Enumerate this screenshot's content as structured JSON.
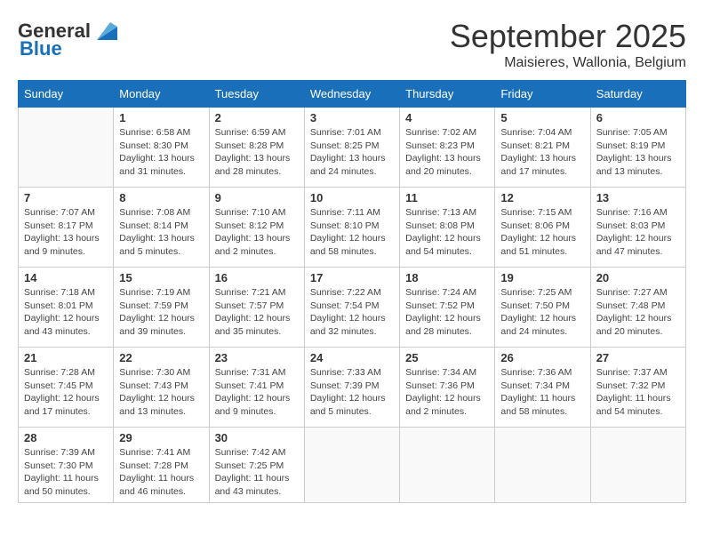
{
  "header": {
    "logo_general": "General",
    "logo_blue": "Blue",
    "month_title": "September 2025",
    "location": "Maisieres, Wallonia, Belgium"
  },
  "days_of_week": [
    "Sunday",
    "Monday",
    "Tuesday",
    "Wednesday",
    "Thursday",
    "Friday",
    "Saturday"
  ],
  "weeks": [
    [
      {
        "day": "",
        "info": ""
      },
      {
        "day": "1",
        "info": "Sunrise: 6:58 AM\nSunset: 8:30 PM\nDaylight: 13 hours\nand 31 minutes."
      },
      {
        "day": "2",
        "info": "Sunrise: 6:59 AM\nSunset: 8:28 PM\nDaylight: 13 hours\nand 28 minutes."
      },
      {
        "day": "3",
        "info": "Sunrise: 7:01 AM\nSunset: 8:25 PM\nDaylight: 13 hours\nand 24 minutes."
      },
      {
        "day": "4",
        "info": "Sunrise: 7:02 AM\nSunset: 8:23 PM\nDaylight: 13 hours\nand 20 minutes."
      },
      {
        "day": "5",
        "info": "Sunrise: 7:04 AM\nSunset: 8:21 PM\nDaylight: 13 hours\nand 17 minutes."
      },
      {
        "day": "6",
        "info": "Sunrise: 7:05 AM\nSunset: 8:19 PM\nDaylight: 13 hours\nand 13 minutes."
      }
    ],
    [
      {
        "day": "7",
        "info": "Sunrise: 7:07 AM\nSunset: 8:17 PM\nDaylight: 13 hours\nand 9 minutes."
      },
      {
        "day": "8",
        "info": "Sunrise: 7:08 AM\nSunset: 8:14 PM\nDaylight: 13 hours\nand 5 minutes."
      },
      {
        "day": "9",
        "info": "Sunrise: 7:10 AM\nSunset: 8:12 PM\nDaylight: 13 hours\nand 2 minutes."
      },
      {
        "day": "10",
        "info": "Sunrise: 7:11 AM\nSunset: 8:10 PM\nDaylight: 12 hours\nand 58 minutes."
      },
      {
        "day": "11",
        "info": "Sunrise: 7:13 AM\nSunset: 8:08 PM\nDaylight: 12 hours\nand 54 minutes."
      },
      {
        "day": "12",
        "info": "Sunrise: 7:15 AM\nSunset: 8:06 PM\nDaylight: 12 hours\nand 51 minutes."
      },
      {
        "day": "13",
        "info": "Sunrise: 7:16 AM\nSunset: 8:03 PM\nDaylight: 12 hours\nand 47 minutes."
      }
    ],
    [
      {
        "day": "14",
        "info": "Sunrise: 7:18 AM\nSunset: 8:01 PM\nDaylight: 12 hours\nand 43 minutes."
      },
      {
        "day": "15",
        "info": "Sunrise: 7:19 AM\nSunset: 7:59 PM\nDaylight: 12 hours\nand 39 minutes."
      },
      {
        "day": "16",
        "info": "Sunrise: 7:21 AM\nSunset: 7:57 PM\nDaylight: 12 hours\nand 35 minutes."
      },
      {
        "day": "17",
        "info": "Sunrise: 7:22 AM\nSunset: 7:54 PM\nDaylight: 12 hours\nand 32 minutes."
      },
      {
        "day": "18",
        "info": "Sunrise: 7:24 AM\nSunset: 7:52 PM\nDaylight: 12 hours\nand 28 minutes."
      },
      {
        "day": "19",
        "info": "Sunrise: 7:25 AM\nSunset: 7:50 PM\nDaylight: 12 hours\nand 24 minutes."
      },
      {
        "day": "20",
        "info": "Sunrise: 7:27 AM\nSunset: 7:48 PM\nDaylight: 12 hours\nand 20 minutes."
      }
    ],
    [
      {
        "day": "21",
        "info": "Sunrise: 7:28 AM\nSunset: 7:45 PM\nDaylight: 12 hours\nand 17 minutes."
      },
      {
        "day": "22",
        "info": "Sunrise: 7:30 AM\nSunset: 7:43 PM\nDaylight: 12 hours\nand 13 minutes."
      },
      {
        "day": "23",
        "info": "Sunrise: 7:31 AM\nSunset: 7:41 PM\nDaylight: 12 hours\nand 9 minutes."
      },
      {
        "day": "24",
        "info": "Sunrise: 7:33 AM\nSunset: 7:39 PM\nDaylight: 12 hours\nand 5 minutes."
      },
      {
        "day": "25",
        "info": "Sunrise: 7:34 AM\nSunset: 7:36 PM\nDaylight: 12 hours\nand 2 minutes."
      },
      {
        "day": "26",
        "info": "Sunrise: 7:36 AM\nSunset: 7:34 PM\nDaylight: 11 hours\nand 58 minutes."
      },
      {
        "day": "27",
        "info": "Sunrise: 7:37 AM\nSunset: 7:32 PM\nDaylight: 11 hours\nand 54 minutes."
      }
    ],
    [
      {
        "day": "28",
        "info": "Sunrise: 7:39 AM\nSunset: 7:30 PM\nDaylight: 11 hours\nand 50 minutes."
      },
      {
        "day": "29",
        "info": "Sunrise: 7:41 AM\nSunset: 7:28 PM\nDaylight: 11 hours\nand 46 minutes."
      },
      {
        "day": "30",
        "info": "Sunrise: 7:42 AM\nSunset: 7:25 PM\nDaylight: 11 hours\nand 43 minutes."
      },
      {
        "day": "",
        "info": ""
      },
      {
        "day": "",
        "info": ""
      },
      {
        "day": "",
        "info": ""
      },
      {
        "day": "",
        "info": ""
      }
    ]
  ]
}
